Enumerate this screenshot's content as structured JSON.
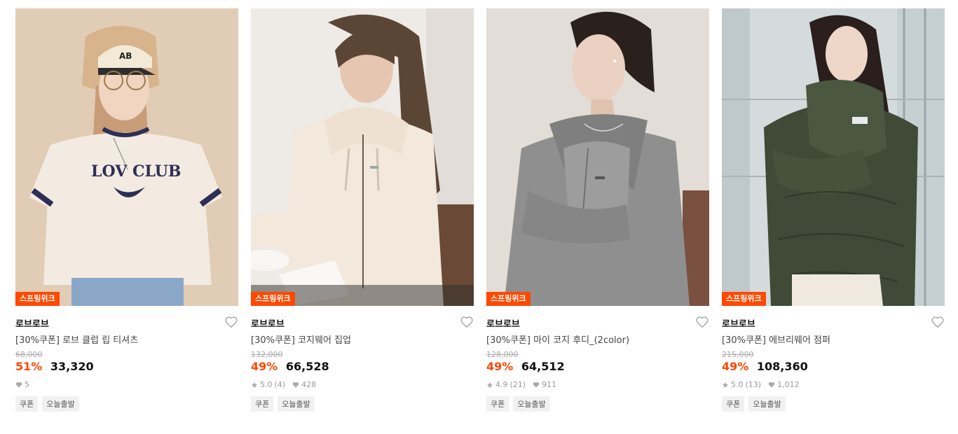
{
  "products": [
    {
      "badge": "스프링위크",
      "brand": "로브로브",
      "title": "[30%쿠폰] 로브 클럽 립 티셔츠",
      "original_price": "68,000",
      "discount": "51%",
      "price": "33,320",
      "rating": "",
      "reviews": "",
      "likes": "5",
      "tags": [
        "쿠폰",
        "오늘출발"
      ]
    },
    {
      "badge": "스프링위크",
      "brand": "로브로브",
      "title": "[30%쿠폰] 코지웨어 집업",
      "original_price": "132,000",
      "discount": "49%",
      "price": "66,528",
      "rating": "5.0",
      "reviews": "(4)",
      "likes": "428",
      "tags": [
        "쿠폰",
        "오늘출발"
      ]
    },
    {
      "badge": "스프링위크",
      "brand": "로브로브",
      "title": "[30%쿠폰] 마이 코지 후디_(2color)",
      "original_price": "128,000",
      "discount": "49%",
      "price": "64,512",
      "rating": "4.9",
      "reviews": "(21)",
      "likes": "911",
      "tags": [
        "쿠폰",
        "오늘출발"
      ]
    },
    {
      "badge": "스프링위크",
      "brand": "로브로브",
      "title": "[30%쿠폰] 에브리웨어 점퍼",
      "original_price": "215,000",
      "discount": "49%",
      "price": "108,360",
      "rating": "5.0",
      "reviews": "(13)",
      "likes": "1,012",
      "tags": [
        "쿠폰",
        "오늘출발"
      ]
    }
  ],
  "photo_text": {
    "tee_print": "LOV CLUB",
    "cap_print": "AB"
  },
  "colors": {
    "accent": "#ff4800",
    "muted": "#999999"
  }
}
